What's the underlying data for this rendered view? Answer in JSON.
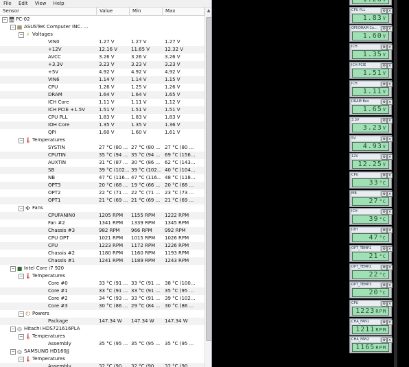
{
  "menu": [
    "File",
    "Edit",
    "View",
    "Help"
  ],
  "columns": {
    "sensor": "Sensor",
    "value": "Value",
    "min": "Min",
    "max": "Max"
  },
  "rows": [
    {
      "level": 0,
      "type": "pc",
      "label": "PC-02"
    },
    {
      "level": 1,
      "type": "board",
      "label": "ASUSTeK Computer INC. ..."
    },
    {
      "level": 2,
      "type": "volt",
      "label": "Voltages"
    },
    {
      "level": 3,
      "label": "VIN0",
      "value": "1.27 V",
      "min": "1.27 V",
      "max": "1.27 V"
    },
    {
      "level": 3,
      "label": "+12V",
      "value": "12.16 V",
      "min": "11.65 V",
      "max": "12.32 V"
    },
    {
      "level": 3,
      "label": "AVCC",
      "value": "3.26 V",
      "min": "3.26 V",
      "max": "3.26 V"
    },
    {
      "level": 3,
      "label": "+3.3V",
      "value": "3.23 V",
      "min": "3.23 V",
      "max": "3.23 V"
    },
    {
      "level": 3,
      "label": "+5V",
      "value": "4.92 V",
      "min": "4.92 V",
      "max": "4.92 V"
    },
    {
      "level": 3,
      "label": "VIN6",
      "value": "1.14 V",
      "min": "1.14 V",
      "max": "1.15 V"
    },
    {
      "level": 3,
      "label": "CPU",
      "value": "1.26 V",
      "min": "1.25 V",
      "max": "1.26 V"
    },
    {
      "level": 3,
      "label": "DRAM",
      "value": "1.64 V",
      "min": "1.64 V",
      "max": "1.65 V"
    },
    {
      "level": 3,
      "label": "ICH Core",
      "value": "1.11 V",
      "min": "1.11 V",
      "max": "1.12 V"
    },
    {
      "level": 3,
      "label": "ICH PCIE +1.5V",
      "value": "1.51 V",
      "min": "1.51 V",
      "max": "1.51 V"
    },
    {
      "level": 3,
      "label": "CPU PLL",
      "value": "1.83 V",
      "min": "1.83 V",
      "max": "1.83 V"
    },
    {
      "level": 3,
      "label": "IOH Core",
      "value": "1.35 V",
      "min": "1.35 V",
      "max": "1.36 V"
    },
    {
      "level": 3,
      "label": "QPI",
      "value": "1.60 V",
      "min": "1.60 V",
      "max": "1.61 V"
    },
    {
      "level": 2,
      "type": "temp",
      "label": "Temperatures"
    },
    {
      "level": 3,
      "label": "SYSTIN",
      "value": "27 °C (80 ...",
      "min": "27 °C (80 ...",
      "max": "27 °C (80 ..."
    },
    {
      "level": 3,
      "label": "CPUTIN",
      "value": "35 °C (94 ...",
      "min": "35 °C (94 ...",
      "max": "69 °C (156..."
    },
    {
      "level": 3,
      "label": "AUXTIN",
      "value": "31 °C (87 ...",
      "min": "30 °C (86 ...",
      "max": "62 °C (143..."
    },
    {
      "level": 3,
      "label": "SB",
      "value": "39 °C (102...",
      "min": "39 °C (102...",
      "max": "40 °C (104..."
    },
    {
      "level": 3,
      "label": "NB",
      "value": "47 °C (116...",
      "min": "47 °C (116...",
      "max": "48 °C (118..."
    },
    {
      "level": 3,
      "label": "OPT3",
      "value": "20 °C (68 ...",
      "min": "19 °C (66 ...",
      "max": "20 °C (68 ..."
    },
    {
      "level": 3,
      "label": "OPT2",
      "value": "22 °C (71 ...",
      "min": "22 °C (71 ...",
      "max": "23 °C (73 ..."
    },
    {
      "level": 3,
      "label": "OPT1",
      "value": "21 °C (69 ...",
      "min": "21 °C (69 ...",
      "max": "21 °C (69 ..."
    },
    {
      "level": 2,
      "type": "fan",
      "label": "Fans"
    },
    {
      "level": 3,
      "label": "CPUFANIN0",
      "value": "1205 RPM",
      "min": "1155 RPM",
      "max": "1222 RPM"
    },
    {
      "level": 3,
      "label": "Fan #2",
      "value": "1341 RPM",
      "min": "1339 RPM",
      "max": "1345 RPM"
    },
    {
      "level": 3,
      "label": "Chassis #3",
      "value": "982 RPM",
      "min": "966 RPM",
      "max": "992 RPM"
    },
    {
      "level": 3,
      "label": "CPU OPT",
      "value": "1021 RPM",
      "min": "1015 RPM",
      "max": "1026 RPM"
    },
    {
      "level": 3,
      "label": "CPU",
      "value": "1223 RPM",
      "min": "1172 RPM",
      "max": "1226 RPM"
    },
    {
      "level": 3,
      "label": "Chassis #2",
      "value": "1180 RPM",
      "min": "1160 RPM",
      "max": "1193 RPM"
    },
    {
      "level": 3,
      "label": "Chassis #1",
      "value": "1241 RPM",
      "min": "1189 RPM",
      "max": "1243 RPM"
    },
    {
      "level": 1,
      "type": "cpu",
      "label": "Intel Core i7 920"
    },
    {
      "level": 2,
      "type": "temp",
      "label": "Temperatures"
    },
    {
      "level": 3,
      "label": "Core #0",
      "value": "33 °C (91 ...",
      "min": "33 °C (91 ...",
      "max": "38 °C (100..."
    },
    {
      "level": 3,
      "label": "Core #1",
      "value": "33 °C (91 ...",
      "min": "33 °C (91 ...",
      "max": "35 °C (95 ..."
    },
    {
      "level": 3,
      "label": "Core #2",
      "value": "34 °C (93 ...",
      "min": "33 °C (91 ...",
      "max": "39 °C (102..."
    },
    {
      "level": 3,
      "label": "Core #3",
      "value": "30 °C (86 ...",
      "min": "29 °C (84 ...",
      "max": "30 °C (86 ..."
    },
    {
      "level": 2,
      "type": "power",
      "label": "Powers"
    },
    {
      "level": 3,
      "label": "Package",
      "value": "147.34 W",
      "min": "147.34 W",
      "max": "147.34 W"
    },
    {
      "level": 1,
      "type": "hdd",
      "label": "Hitachi HDS721616PLA"
    },
    {
      "level": 2,
      "type": "temp",
      "label": "Temperatures"
    },
    {
      "level": 3,
      "label": "Assembly",
      "value": "35 °C (95 ...",
      "min": "35 °C (95 ...",
      "max": "35 °C (95 ..."
    },
    {
      "level": 1,
      "type": "hdd",
      "label": "SAMSUNG HD160JJ"
    },
    {
      "level": 2,
      "type": "temp",
      "label": "Temperatures"
    },
    {
      "level": 3,
      "label": "Assembly",
      "value": "32 °C (90 ...",
      "min": "32 °C (90 ...",
      "max": "32 °C (90 ..."
    }
  ],
  "gadgets": [
    {
      "title": "",
      "value": "1.26",
      "unit": "V"
    },
    {
      "title": "CPU PLL",
      "value": "1.83",
      "unit": "V"
    },
    {
      "title": "QPI/DRAM Co...",
      "value": "1.60",
      "unit": "V"
    },
    {
      "title": "ICH",
      "value": "1.35",
      "unit": "V"
    },
    {
      "title": "ICH PCIE",
      "value": "1.51",
      "unit": "V"
    },
    {
      "title": "ICH",
      "value": "1.11",
      "unit": "V"
    },
    {
      "title": "DRAM Bus",
      "value": "1.65",
      "unit": "V"
    },
    {
      "title": "3.3V",
      "value": "3.23",
      "unit": "V"
    },
    {
      "title": "5V",
      "value": "4.93",
      "unit": "V"
    },
    {
      "title": "12V",
      "value": "12.25",
      "unit": "V"
    },
    {
      "title": "CPU",
      "value": "33",
      "unit": "°C"
    },
    {
      "title": "MB",
      "value": "27",
      "unit": "°C"
    },
    {
      "title": "ICH",
      "value": "39",
      "unit": "°C"
    },
    {
      "title": "IOH",
      "value": "47",
      "unit": "°C"
    },
    {
      "title": "OPT_TEMP1",
      "value": "21",
      "unit": "°C"
    },
    {
      "title": "OPT_TEMP2",
      "value": "22",
      "unit": "°C"
    },
    {
      "title": "OPT_TEMP3",
      "value": "20",
      "unit": "°C"
    },
    {
      "title": "CPU",
      "value": "1223",
      "unit": "RPM"
    },
    {
      "title": "CHA_FAN1",
      "value": "1211",
      "unit": "RPM"
    },
    {
      "title": "CHA_FAN2",
      "value": "1165",
      "unit": "RPM"
    }
  ]
}
